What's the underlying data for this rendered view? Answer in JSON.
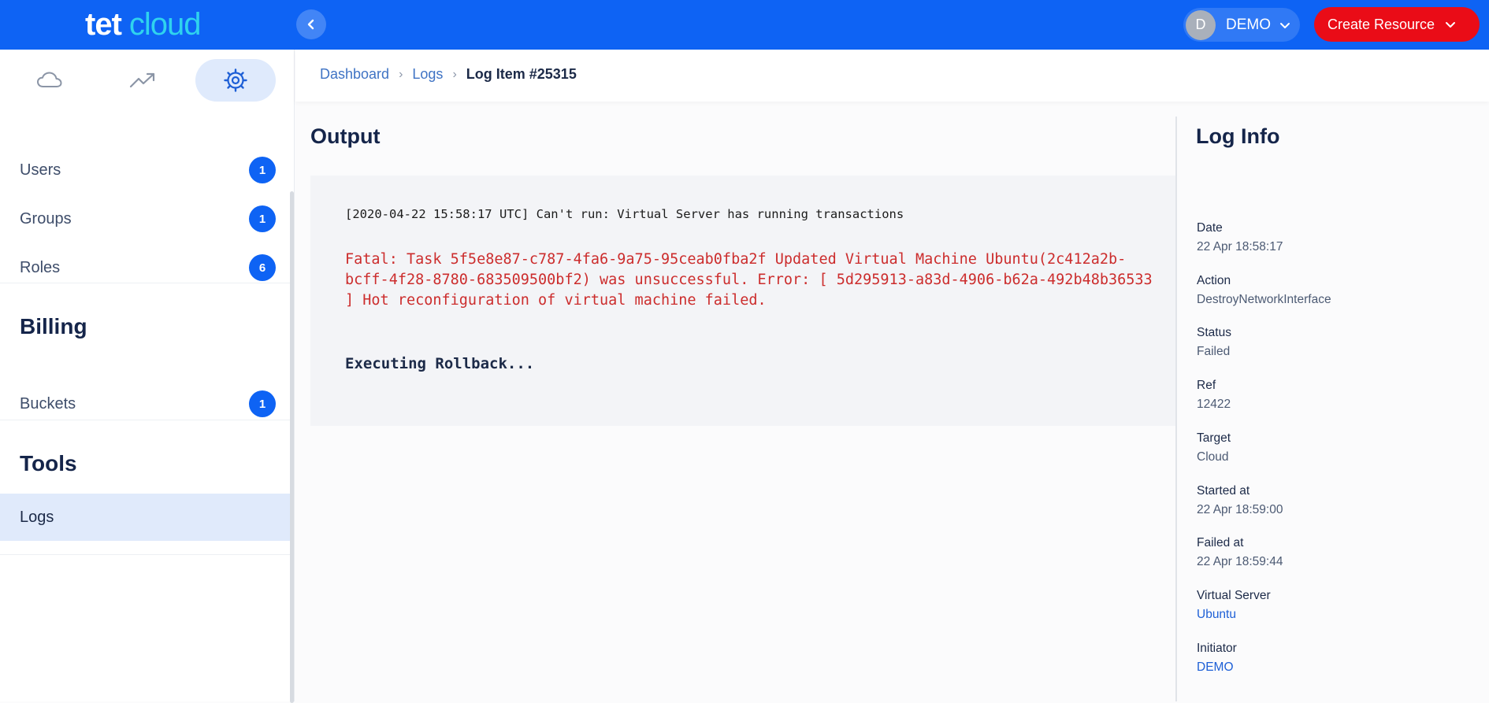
{
  "brand": {
    "part1": "tet",
    "part2": "cloud"
  },
  "header": {
    "user_initial": "D",
    "user_name": "DEMO",
    "create_label": "Create Resource"
  },
  "sidebar": {
    "icons": [
      "cloud-icon",
      "trending-icon",
      "settings-icon"
    ],
    "items": [
      {
        "label": "Users",
        "badge": "1"
      },
      {
        "label": "Groups",
        "badge": "1"
      },
      {
        "label": "Roles",
        "badge": "6"
      },
      {
        "label": "Buckets",
        "badge": "1"
      },
      {
        "label": "Logs"
      }
    ],
    "sections": {
      "billing": "Billing",
      "tools": "Tools"
    }
  },
  "breadcrumb": {
    "items": [
      "Dashboard",
      "Logs"
    ],
    "current": "Log Item #25315"
  },
  "output": {
    "title": "Output",
    "line1": "[2020-04-22 15:58:17 UTC] Can't run: Virtual Server has running transactions",
    "error": "Fatal: Task 5f5e8e87-c787-4fa6-9a75-95ceab0fba2f Updated Virtual Machine Ubuntu(2c412a2b-bcff-4f28-8780-683509500bf2) was unsuccessful. Error: [ 5d295913-a83d-4906-b62a-492b48b36533 ] Hot reconfiguration of virtual machine failed.",
    "rollback": "Executing Rollback..."
  },
  "log_info": {
    "title": "Log Info",
    "fields": [
      {
        "label": "Date",
        "value": "22 Apr 18:58:17"
      },
      {
        "label": "Action",
        "value": "DestroyNetworkInterface"
      },
      {
        "label": "Status",
        "value": "Failed"
      },
      {
        "label": "Ref",
        "value": "12422"
      },
      {
        "label": "Target",
        "value": "Cloud"
      },
      {
        "label": "Started at",
        "value": "22 Apr 18:59:00"
      },
      {
        "label": "Failed at",
        "value": "22 Apr 18:59:44"
      },
      {
        "label": "Virtual Server",
        "value": "Ubuntu"
      },
      {
        "label": "Initiator",
        "value": "DEMO"
      }
    ]
  },
  "colors": {
    "topbar": "#0e63f4",
    "create_button": "#ea0c17",
    "badge": "#0e63f4",
    "error_text": "#cc2d2d",
    "link": "#1d5fd6"
  }
}
